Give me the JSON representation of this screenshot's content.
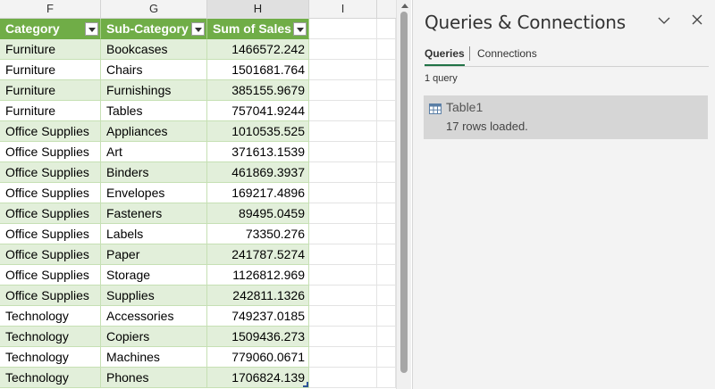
{
  "sheet": {
    "column_headers": [
      "F",
      "G",
      "H",
      "I"
    ],
    "table": {
      "headers": [
        "Category",
        "Sub-Category",
        "Sum of Sales"
      ],
      "rows": [
        [
          "Furniture",
          "Bookcases",
          "1466572.242"
        ],
        [
          "Furniture",
          "Chairs",
          "1501681.764"
        ],
        [
          "Furniture",
          "Furnishings",
          "385155.9679"
        ],
        [
          "Furniture",
          "Tables",
          "757041.9244"
        ],
        [
          "Office Supplies",
          "Appliances",
          "1010535.525"
        ],
        [
          "Office Supplies",
          "Art",
          "371613.1539"
        ],
        [
          "Office Supplies",
          "Binders",
          "461869.3937"
        ],
        [
          "Office Supplies",
          "Envelopes",
          "169217.4896"
        ],
        [
          "Office Supplies",
          "Fasteners",
          "89495.0459"
        ],
        [
          "Office Supplies",
          "Labels",
          "73350.276"
        ],
        [
          "Office Supplies",
          "Paper",
          "241787.5274"
        ],
        [
          "Office Supplies",
          "Storage",
          "1126812.969"
        ],
        [
          "Office Supplies",
          "Supplies",
          "242811.1326"
        ],
        [
          "Technology",
          "Accessories",
          "749237.0185"
        ],
        [
          "Technology",
          "Copiers",
          "1509436.273"
        ],
        [
          "Technology",
          "Machines",
          "779060.0671"
        ],
        [
          "Technology",
          "Phones",
          "1706824.139"
        ]
      ]
    },
    "colors": {
      "header_bg": "#70ad47",
      "band_bg": "#e2efda"
    }
  },
  "pane": {
    "title": "Queries & Connections",
    "collapse_icon": "chevron-down-icon",
    "close_icon": "close-icon",
    "tabs": [
      {
        "label": "Queries",
        "active": true
      },
      {
        "label": "Connections",
        "active": false
      }
    ],
    "query_count": "1 query",
    "query": {
      "icon": "table-icon",
      "name": "Table1",
      "status": "17 rows loaded."
    },
    "accent_color": "#217346"
  }
}
